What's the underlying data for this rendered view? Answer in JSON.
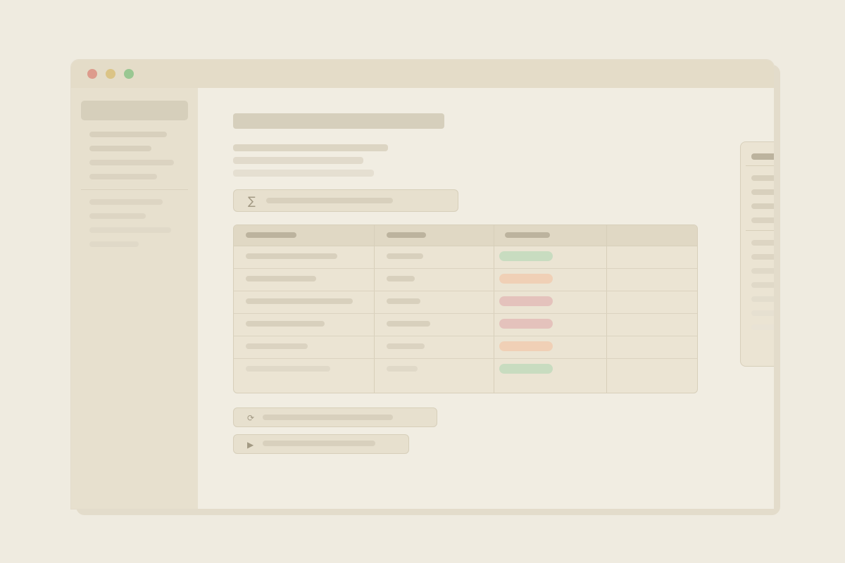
{
  "window": {
    "controls": [
      {
        "name": "close",
        "color": "#dd9b8c"
      },
      {
        "name": "minimize",
        "color": "#dbc486"
      },
      {
        "name": "maximize",
        "color": "#99c792"
      }
    ]
  },
  "icons": {
    "sum": "∑",
    "refresh": "⟳",
    "play": "▶"
  },
  "colors": {
    "status_success": "#c8dcc0",
    "status_warning": "#f0d0b6",
    "status_error": "#e4c2bc"
  },
  "table": {
    "row_statuses": [
      "success",
      "warning",
      "error",
      "error",
      "warning",
      "success"
    ]
  }
}
